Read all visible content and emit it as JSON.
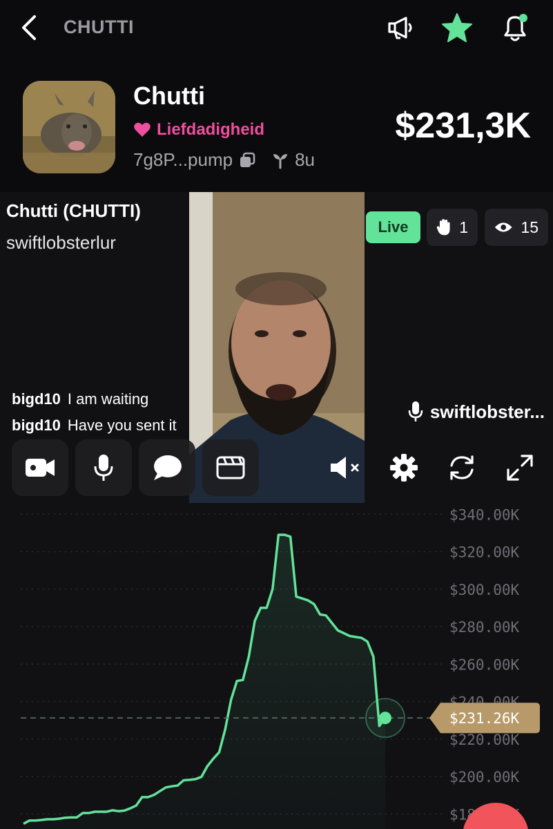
{
  "header": {
    "title": "CHUTTI"
  },
  "token": {
    "name": "Chutti",
    "category": "Liefdadigheid",
    "address": "7g8P...pump",
    "age": "8u",
    "market_cap": "$231,3K"
  },
  "stream": {
    "title": "Chutti (CHUTTI)",
    "host": "swiftlobsterlur",
    "live_label": "Live",
    "raised_hands": "1",
    "viewers": "15",
    "speaker": "swiftlobster...",
    "chat": [
      {
        "user": "bigd10",
        "message": "I am waiting"
      },
      {
        "user": "bigd10",
        "message": "Have you sent it"
      }
    ]
  },
  "colors": {
    "accent_green": "#63e39a",
    "pink": "#ef4f9e",
    "price_tag": "#b89a6a",
    "fab_red": "#f2545b"
  },
  "chart_data": {
    "type": "line",
    "title": "",
    "xlabel": "",
    "ylabel": "",
    "ylim": [
      172000,
      346000
    ],
    "ytick_values": [
      340000,
      320000,
      300000,
      280000,
      260000,
      240000,
      220000,
      200000,
      180000
    ],
    "yticks": [
      "$340.00K",
      "$320.00K",
      "$300.00K",
      "$280.00K",
      "$260.00K",
      "$240.00K",
      "$220.00K",
      "$200.00K",
      "$180.00K"
    ],
    "current_value": 231260,
    "current_label": "$231.26K",
    "grid": true,
    "series": [
      {
        "values": [
          174800,
          176500,
          176500,
          176800,
          177200,
          177200,
          177500,
          178000,
          178200,
          178200,
          180500,
          180500,
          181200,
          181200,
          181200,
          182000,
          181500,
          181800,
          183000,
          184500,
          189000,
          189000,
          190200,
          192200,
          194200,
          194800,
          195200,
          198000,
          198200,
          198600,
          199800,
          205500,
          209500,
          213000,
          225000,
          241000,
          251000,
          251500,
          264000,
          283000,
          290000,
          290000,
          300000,
          329000,
          329000,
          328000,
          296000,
          295000,
          294000,
          292000,
          286500,
          286000,
          282000,
          278000,
          276500,
          275000,
          274500,
          274000,
          272000,
          264000,
          227000,
          231260
        ]
      }
    ]
  }
}
